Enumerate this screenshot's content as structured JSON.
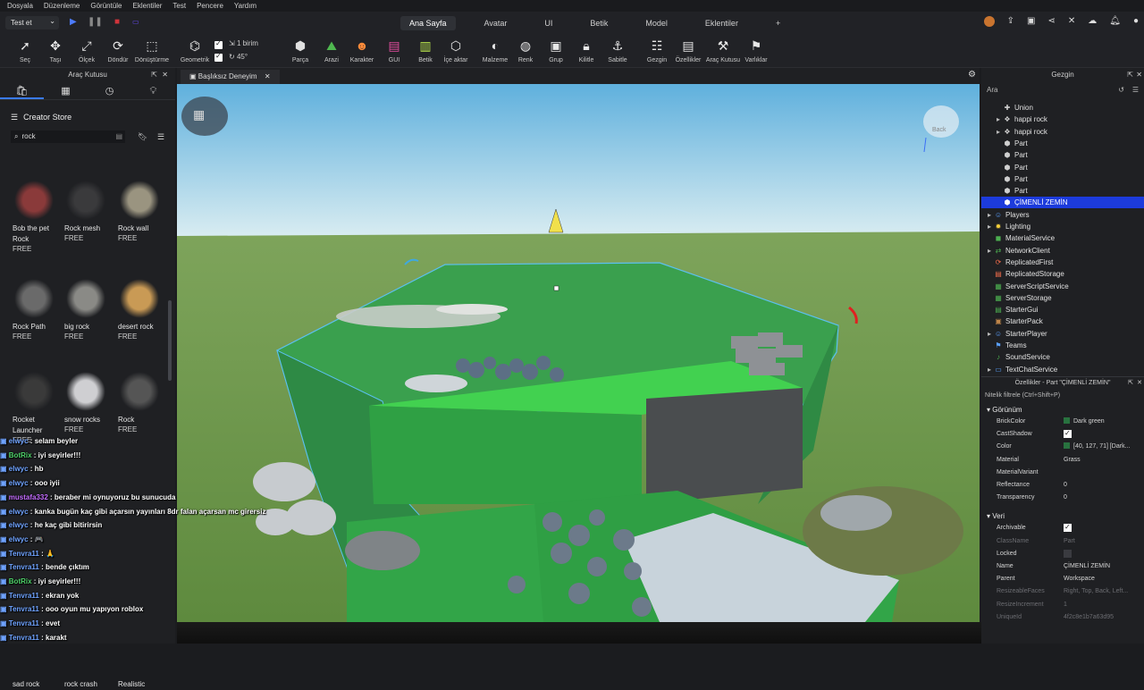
{
  "menu": [
    "Dosyala",
    "Düzenleme",
    "Görüntüle",
    "Eklentiler",
    "Test",
    "Pencere",
    "Yardım"
  ],
  "testButton": "Test et",
  "ribbonTabs": [
    {
      "label": "Ana Sayfa",
      "active": true
    },
    {
      "label": "Avatar"
    },
    {
      "label": "UI"
    },
    {
      "label": "Betik"
    },
    {
      "label": "Model"
    },
    {
      "label": "Eklentiler"
    },
    {
      "label": "+"
    }
  ],
  "tools": [
    {
      "label": "Seç",
      "icon": "cursor-icon"
    },
    {
      "label": "Taşı",
      "icon": "move-icon"
    },
    {
      "label": "Ölçek",
      "icon": "scale-icon"
    },
    {
      "label": "Döndür",
      "icon": "rotate-icon"
    },
    {
      "label": "Dönüştürme",
      "icon": "transform-icon"
    },
    {
      "label": "Geometrik",
      "icon": "geometric-icon"
    },
    {
      "label": "Parça",
      "icon": "part-icon"
    },
    {
      "label": "Arazi",
      "icon": "terrain-icon"
    },
    {
      "label": "Karakter",
      "icon": "character-icon"
    },
    {
      "label": "GUI",
      "icon": "gui-icon"
    },
    {
      "label": "Betik",
      "icon": "script-icon"
    },
    {
      "label": "İçe aktar",
      "icon": "import-icon"
    },
    {
      "label": "Malzeme",
      "icon": "material-icon"
    },
    {
      "label": "Renk",
      "icon": "color-icon"
    },
    {
      "label": "Grup",
      "icon": "group-icon"
    },
    {
      "label": "Kilitle",
      "icon": "lock-icon"
    },
    {
      "label": "Sabitle",
      "icon": "anchor-icon"
    },
    {
      "label": "Gezgin",
      "icon": "explorer-icon"
    },
    {
      "label": "Özellikler",
      "icon": "properties-icon"
    },
    {
      "label": "Araç Kutusu",
      "icon": "toolbox-icon"
    },
    {
      "label": "Varlıklar",
      "icon": "assets-icon"
    }
  ],
  "snap": {
    "move": "1 birim",
    "rotate": "45°"
  },
  "toolbox": {
    "title": "Araç Kutusu",
    "storeTitle": "Creator Store",
    "searchValue": "rock",
    "assets": [
      {
        "name": "Bob the pet Rock",
        "price": "FREE",
        "color": "#8a3a3a"
      },
      {
        "name": "Rock mesh",
        "price": "FREE",
        "color": "#3a3a3c"
      },
      {
        "name": "Rock wall",
        "price": "FREE",
        "color": "#9a9480"
      },
      {
        "name": "Rock Path",
        "price": "FREE",
        "color": "#6a6a6a"
      },
      {
        "name": "big rock",
        "price": "FREE",
        "color": "#8a8a86"
      },
      {
        "name": "desert rock",
        "price": "FREE",
        "color": "#c99a55"
      },
      {
        "name": "Rocket Launcher",
        "price": "FREE",
        "color": "#3a3a3a"
      },
      {
        "name": "snow rocks",
        "price": "FREE",
        "color": "#cfcfd2"
      },
      {
        "name": "Rock",
        "price": "FREE",
        "color": "#555"
      },
      {
        "name": "sad rock",
        "price": "",
        "color": "#aaa"
      },
      {
        "name": "rock crash",
        "price": "",
        "color": "#777"
      },
      {
        "name": "Realistic",
        "price": "",
        "color": "#665e4e"
      }
    ]
  },
  "chat": [
    {
      "user": "elwyc",
      "text": "selam beyler",
      "cls": "u"
    },
    {
      "user": "BotRix",
      "text": "iyi seyirler!!!",
      "cls": "u3"
    },
    {
      "user": "elwyc",
      "text": "hb",
      "cls": "u"
    },
    {
      "user": "elwyc",
      "text": "ooo iyii",
      "cls": "u"
    },
    {
      "user": "mustafa332",
      "text": "beraber mi oynuyoruz bu sunucuda",
      "cls": "u2"
    },
    {
      "user": "elwyc",
      "text": "kanka bugün kaç gibi açarsın yayınları 8dr falan açarsan mc girersiz",
      "cls": "u"
    },
    {
      "user": "elwyc",
      "text": "he kaç gibi bitirirsin",
      "cls": "u"
    },
    {
      "user": "elwyc",
      "text": "🎮",
      "cls": "u"
    },
    {
      "user": "Tenvra11",
      "text": "🙏",
      "cls": "u"
    },
    {
      "user": "Tenvra11",
      "text": "bende çıktım",
      "cls": "u"
    },
    {
      "user": "BotRix",
      "text": "iyi seyirler!!!",
      "cls": "u3"
    },
    {
      "user": "Tenvra11",
      "text": "ekran yok",
      "cls": "u"
    },
    {
      "user": "Tenvra11",
      "text": "ooo oyun mu yapıyon roblox",
      "cls": "u"
    },
    {
      "user": "Tenvra11",
      "text": "evet",
      "cls": "u"
    },
    {
      "user": "Tenvra11",
      "text": "karakt",
      "cls": "u"
    }
  ],
  "viewportTab": "Başlıksız Deneyim",
  "viewCube": "Back",
  "explorer": {
    "title": "Gezgin",
    "searchPlaceholder": "Ara",
    "items": [
      {
        "label": "Union",
        "indent": 1,
        "icon": "union-icon",
        "color": "#cfcfcf"
      },
      {
        "label": "happi rock",
        "indent": 1,
        "icon": "model-icon",
        "color": "#cfcfcf",
        "exp": true
      },
      {
        "label": "happi rock",
        "indent": 1,
        "icon": "model-icon",
        "color": "#cfcfcf",
        "exp": true
      },
      {
        "label": "Part",
        "indent": 1,
        "icon": "part-icon",
        "color": "#cfcfcf"
      },
      {
        "label": "Part",
        "indent": 1,
        "icon": "part-icon",
        "color": "#cfcfcf"
      },
      {
        "label": "Part",
        "indent": 1,
        "icon": "part-icon",
        "color": "#cfcfcf"
      },
      {
        "label": "Part",
        "indent": 1,
        "icon": "part-icon",
        "color": "#cfcfcf"
      },
      {
        "label": "Part",
        "indent": 1,
        "icon": "part-icon",
        "color": "#cfcfcf"
      },
      {
        "label": "ÇİMENLİ ZEMİN",
        "indent": 1,
        "icon": "part-icon",
        "color": "#ffffff",
        "selected": true
      },
      {
        "label": "Players",
        "indent": 0,
        "icon": "players-icon",
        "color": "#5aa0ff",
        "exp": true
      },
      {
        "label": "Lighting",
        "indent": 0,
        "icon": "lighting-icon",
        "color": "#f5d03b",
        "exp": true
      },
      {
        "label": "MaterialService",
        "indent": 0,
        "icon": "material-service-icon",
        "color": "#4caf50"
      },
      {
        "label": "NetworkClient",
        "indent": 0,
        "icon": "network-icon",
        "color": "#4caf50",
        "exp": true
      },
      {
        "label": "ReplicatedFirst",
        "indent": 0,
        "icon": "replicated-first-icon",
        "color": "#ef6b4a"
      },
      {
        "label": "ReplicatedStorage",
        "indent": 0,
        "icon": "replicated-storage-icon",
        "color": "#ef6b4a"
      },
      {
        "label": "ServerScriptService",
        "indent": 0,
        "icon": "server-script-icon",
        "color": "#4caf50"
      },
      {
        "label": "ServerStorage",
        "indent": 0,
        "icon": "server-storage-icon",
        "color": "#4caf50"
      },
      {
        "label": "StarterGui",
        "indent": 0,
        "icon": "starter-gui-icon",
        "color": "#4caf50"
      },
      {
        "label": "StarterPack",
        "indent": 0,
        "icon": "starter-pack-icon",
        "color": "#c2874a"
      },
      {
        "label": "StarterPlayer",
        "indent": 0,
        "icon": "starter-player-icon",
        "color": "#5aa0ff",
        "exp": true
      },
      {
        "label": "Teams",
        "indent": 0,
        "icon": "teams-icon",
        "color": "#5aa0ff"
      },
      {
        "label": "SoundService",
        "indent": 0,
        "icon": "sound-icon",
        "color": "#4caf50"
      },
      {
        "label": "TextChatService",
        "indent": 0,
        "icon": "text-chat-icon",
        "color": "#5aa0ff",
        "exp": true
      }
    ]
  },
  "properties": {
    "title": "Özellikler - Part \"ÇİMENLİ ZEMİN\"",
    "filterPlaceholder": "Nitelik filtrele (Ctrl+Shift+P)",
    "sections": [
      {
        "name": "Görünüm",
        "rows": [
          {
            "k": "BrickColor",
            "v": "Dark green",
            "swatch": true
          },
          {
            "k": "CastShadow",
            "check": true
          },
          {
            "k": "Color",
            "v": "[40, 127, 71] [Dark...",
            "swatch": true
          },
          {
            "k": "Material",
            "v": "Grass"
          },
          {
            "k": "MaterialVariant",
            "v": ""
          },
          {
            "k": "Reflectance",
            "v": "0"
          },
          {
            "k": "Transparency",
            "v": "0"
          }
        ]
      },
      {
        "name": "Veri",
        "rows": [
          {
            "k": "Archivable",
            "check": true
          },
          {
            "k": "ClassName",
            "v": "Part",
            "dim": true
          },
          {
            "k": "Locked",
            "check": false
          },
          {
            "k": "Name",
            "v": "ÇİMENLİ ZEMİN"
          },
          {
            "k": "Parent",
            "v": "Workspace"
          },
          {
            "k": "ResizeableFaces",
            "v": "Right, Top, Back, Left...",
            "dim": true
          },
          {
            "k": "ResizeIncrement",
            "v": "1",
            "dim": true
          },
          {
            "k": "UniqueId",
            "v": "4f2c8e1b7a63d95",
            "dim": true
          }
        ]
      }
    ]
  }
}
